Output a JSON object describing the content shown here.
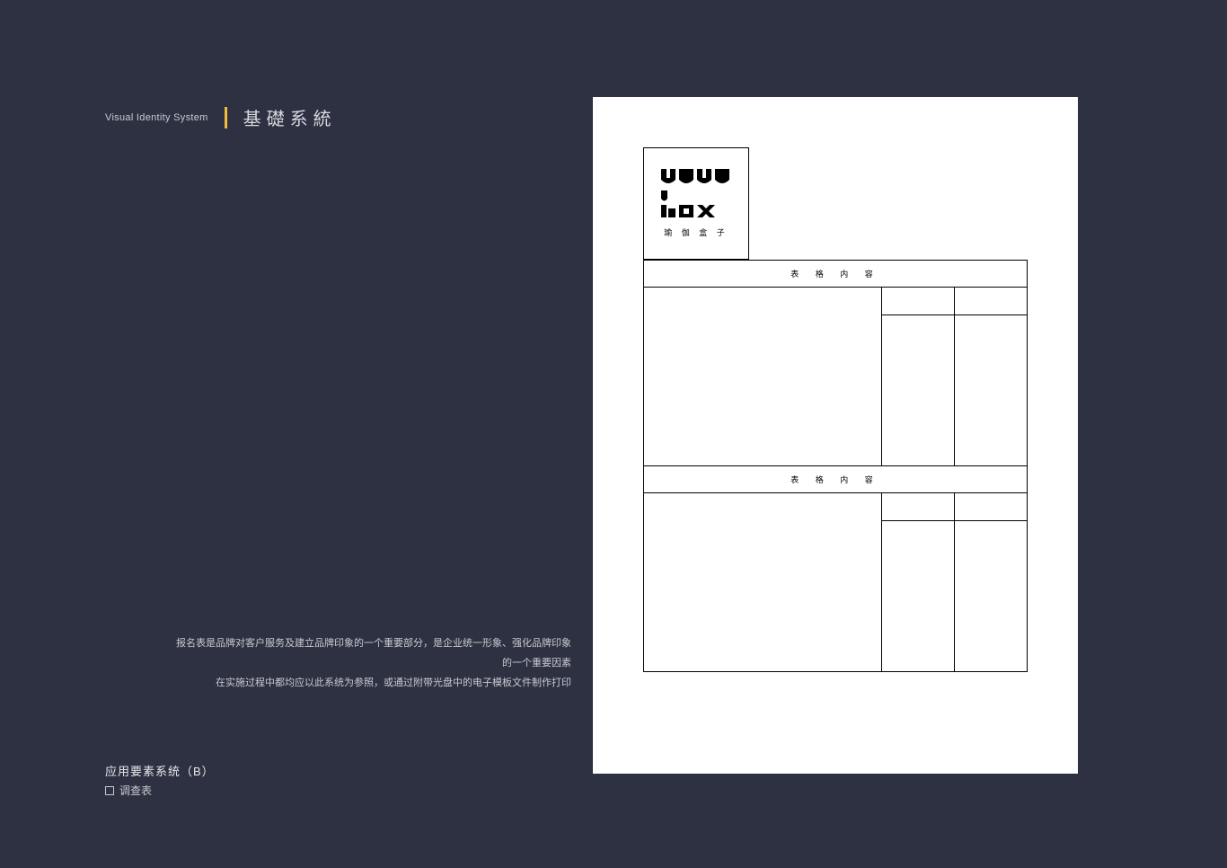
{
  "header": {
    "en": "Visual Identity System",
    "cn": "基礎系統"
  },
  "description": {
    "line1": "报名表是品牌对客户服务及建立品牌印象的一个重要部分，是企业统一形象、强化品牌印象的一个重要因素",
    "line2": "在实施过程中都均应以此系统为参照，或通过附带光盘中的电子模板文件制作打印"
  },
  "footer": {
    "title": "应用要素系统（B）",
    "sub": "调查表"
  },
  "document": {
    "logo_cn": "瑜 伽 盒 子",
    "form_header": "表 格 内 容"
  }
}
